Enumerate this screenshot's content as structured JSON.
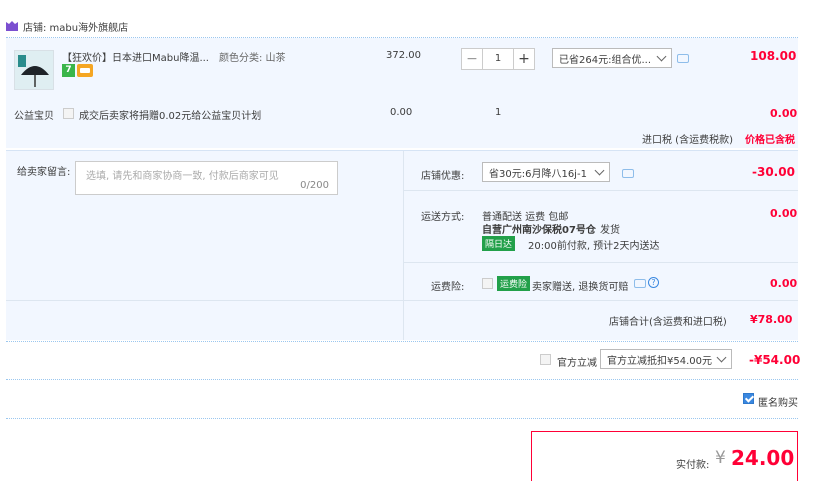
{
  "shop": {
    "label": "店铺: mabu海外旗舰店"
  },
  "item": {
    "title": "【狂欢价】日本进口Mabu降温...",
    "sku_label": "颜色分类: 山茶",
    "badge_num": "7",
    "unit_price": "372.00",
    "qty": "1",
    "discount_select": "已省264元:组合优...",
    "subtotal": "108.00"
  },
  "charity": {
    "label": "公益宝贝",
    "text": "成交后卖家将捐赠0.02元给公益宝贝计划",
    "price": "0.00",
    "qty": "1",
    "subtotal": "0.00"
  },
  "import_tax": {
    "label": "进口税 (含运费税款)",
    "value": "价格已含税"
  },
  "message": {
    "label": "给卖家留言:",
    "placeholder": "选填, 请先和商家协商一致, 付款后商家可见",
    "counter": "0/200"
  },
  "shop_discount": {
    "label": "店铺优惠:",
    "select": "省30元:6月降八16j-1",
    "amount": "-30.00"
  },
  "shipping": {
    "label": "运送方式:",
    "method": "普通配送 运费 包邮",
    "warehouse": "自营广州南沙保税07号仓",
    "ship_note": "发货",
    "tag": "隔日达",
    "timing": "20:00前付款, 预计2天内送达",
    "amount": "0.00"
  },
  "insurance": {
    "label": "运费险:",
    "tag": "运费险",
    "text": "卖家赠送, 退换货可赔",
    "amount": "0.00"
  },
  "shop_total": {
    "label": "店铺合计(含运费和进口税)",
    "value": "¥78.00"
  },
  "official_discount": {
    "label": "官方立减",
    "select": "官方立减抵扣¥54.00元",
    "amount": "-¥54.00"
  },
  "anonymous": {
    "label": "匿名购买"
  },
  "payment": {
    "label": "实付款:",
    "currency": "¥",
    "amount": "24.00"
  },
  "colors": {
    "accent": "#ff0036",
    "brand_blue": "#3a88e0",
    "band": "#f2f7ff"
  }
}
